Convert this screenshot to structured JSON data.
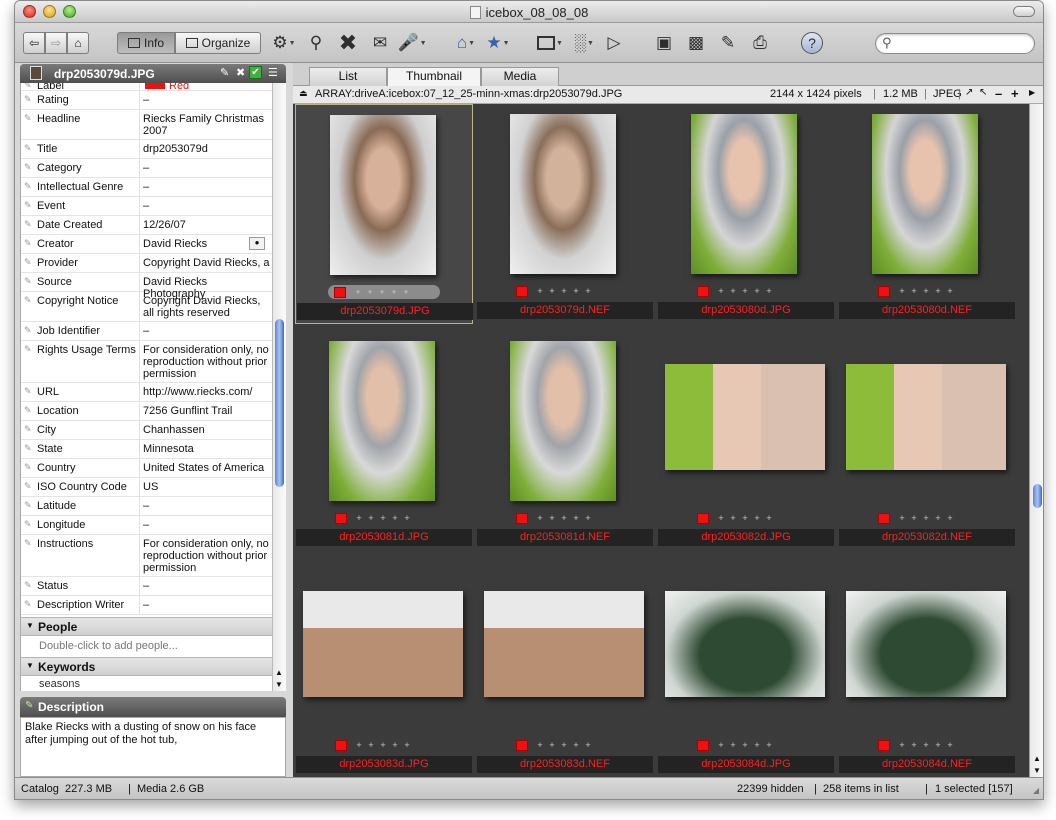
{
  "window": {
    "title": "icebox_08_08_08"
  },
  "toolbar": {
    "info_label": "Info",
    "organize_label": "Organize",
    "search_placeholder": ""
  },
  "left_panel": {
    "header_title": "drp2053079d.JPG",
    "fields": [
      {
        "label": "Label",
        "value": "Red",
        "color": "#ee1111"
      },
      {
        "label": "Rating",
        "value": "–"
      },
      {
        "label": "Headline",
        "value": "Riecks Family Christmas 2007"
      },
      {
        "label": "Title",
        "value": "drp2053079d"
      },
      {
        "label": "Category",
        "value": "–"
      },
      {
        "label": "Intellectual Genre",
        "value": "–"
      },
      {
        "label": "Event",
        "value": "–"
      },
      {
        "label": "Date Created",
        "value": "12/26/07"
      },
      {
        "label": "Creator",
        "value": "David Riecks"
      },
      {
        "label": "Provider",
        "value": "Copyright David Riecks, a"
      },
      {
        "label": "Source",
        "value": "David Riecks Photography"
      },
      {
        "label": "Copyright Notice",
        "value": "Copyright David Riecks, all rights reserved"
      },
      {
        "label": "Job Identifier",
        "value": "–"
      },
      {
        "label": "Rights Usage Terms",
        "value": "For consideration only, no reproduction without prior permission"
      },
      {
        "label": "URL",
        "value": "http://www.riecks.com/"
      },
      {
        "label": "Location",
        "value": "7256 Gunflint Trail"
      },
      {
        "label": "City",
        "value": "Chanhassen"
      },
      {
        "label": "State",
        "value": "Minnesota"
      },
      {
        "label": "Country",
        "value": "United States of America"
      },
      {
        "label": "ISO Country Code",
        "value": "US"
      },
      {
        "label": "Latitude",
        "value": "–"
      },
      {
        "label": "Longitude",
        "value": "–"
      },
      {
        "label": "Instructions",
        "value": "For consideration only, no reproduction without prior permission"
      },
      {
        "label": "Status",
        "value": "–"
      },
      {
        "label": "Description Writer",
        "value": "–"
      }
    ],
    "people": {
      "title": "People",
      "hint": "Double-click to add people..."
    },
    "keywords": {
      "title": "Keywords",
      "first_item": "seasons"
    },
    "description": {
      "title": "Description",
      "text": "Blake Riecks with a dusting of snow on his face after jumping out of the hot tub,"
    }
  },
  "right_panel": {
    "tabs": [
      "List",
      "Thumbnail",
      "Media"
    ],
    "active_tab": "Thumbnail",
    "path": "ARRAY:driveA:icebox:07_12_25-minn-xmas:drp2053079d.JPG",
    "dimensions": "2144 x 1424 pixels",
    "filesize": "1.2 MB",
    "format": "JPEG",
    "thumbnails": [
      {
        "name": "drp2053079d.JPG",
        "selected": true
      },
      {
        "name": "drp2053079d.NEF"
      },
      {
        "name": "drp2053080d.JPG"
      },
      {
        "name": "drp2053080d.NEF"
      },
      {
        "name": "drp2053081d.JPG"
      },
      {
        "name": "drp2053081d.NEF"
      },
      {
        "name": "drp2053082d.JPG"
      },
      {
        "name": "drp2053082d.NEF"
      },
      {
        "name": "drp2053083d.JPG"
      },
      {
        "name": "drp2053083d.NEF"
      },
      {
        "name": "drp2053084d.JPG"
      },
      {
        "name": "drp2053084d.NEF"
      }
    ]
  },
  "status": {
    "catalog": "Catalog  227.3 MB",
    "media": "Media 2.6 GB",
    "hidden": "22399 hidden",
    "items": "258 items in list",
    "selected": "1 selected [157]"
  },
  "colors": {
    "label_red": "#ee1111",
    "filename_red": "#ff2020",
    "grid_bg": "#3b3b3b"
  }
}
